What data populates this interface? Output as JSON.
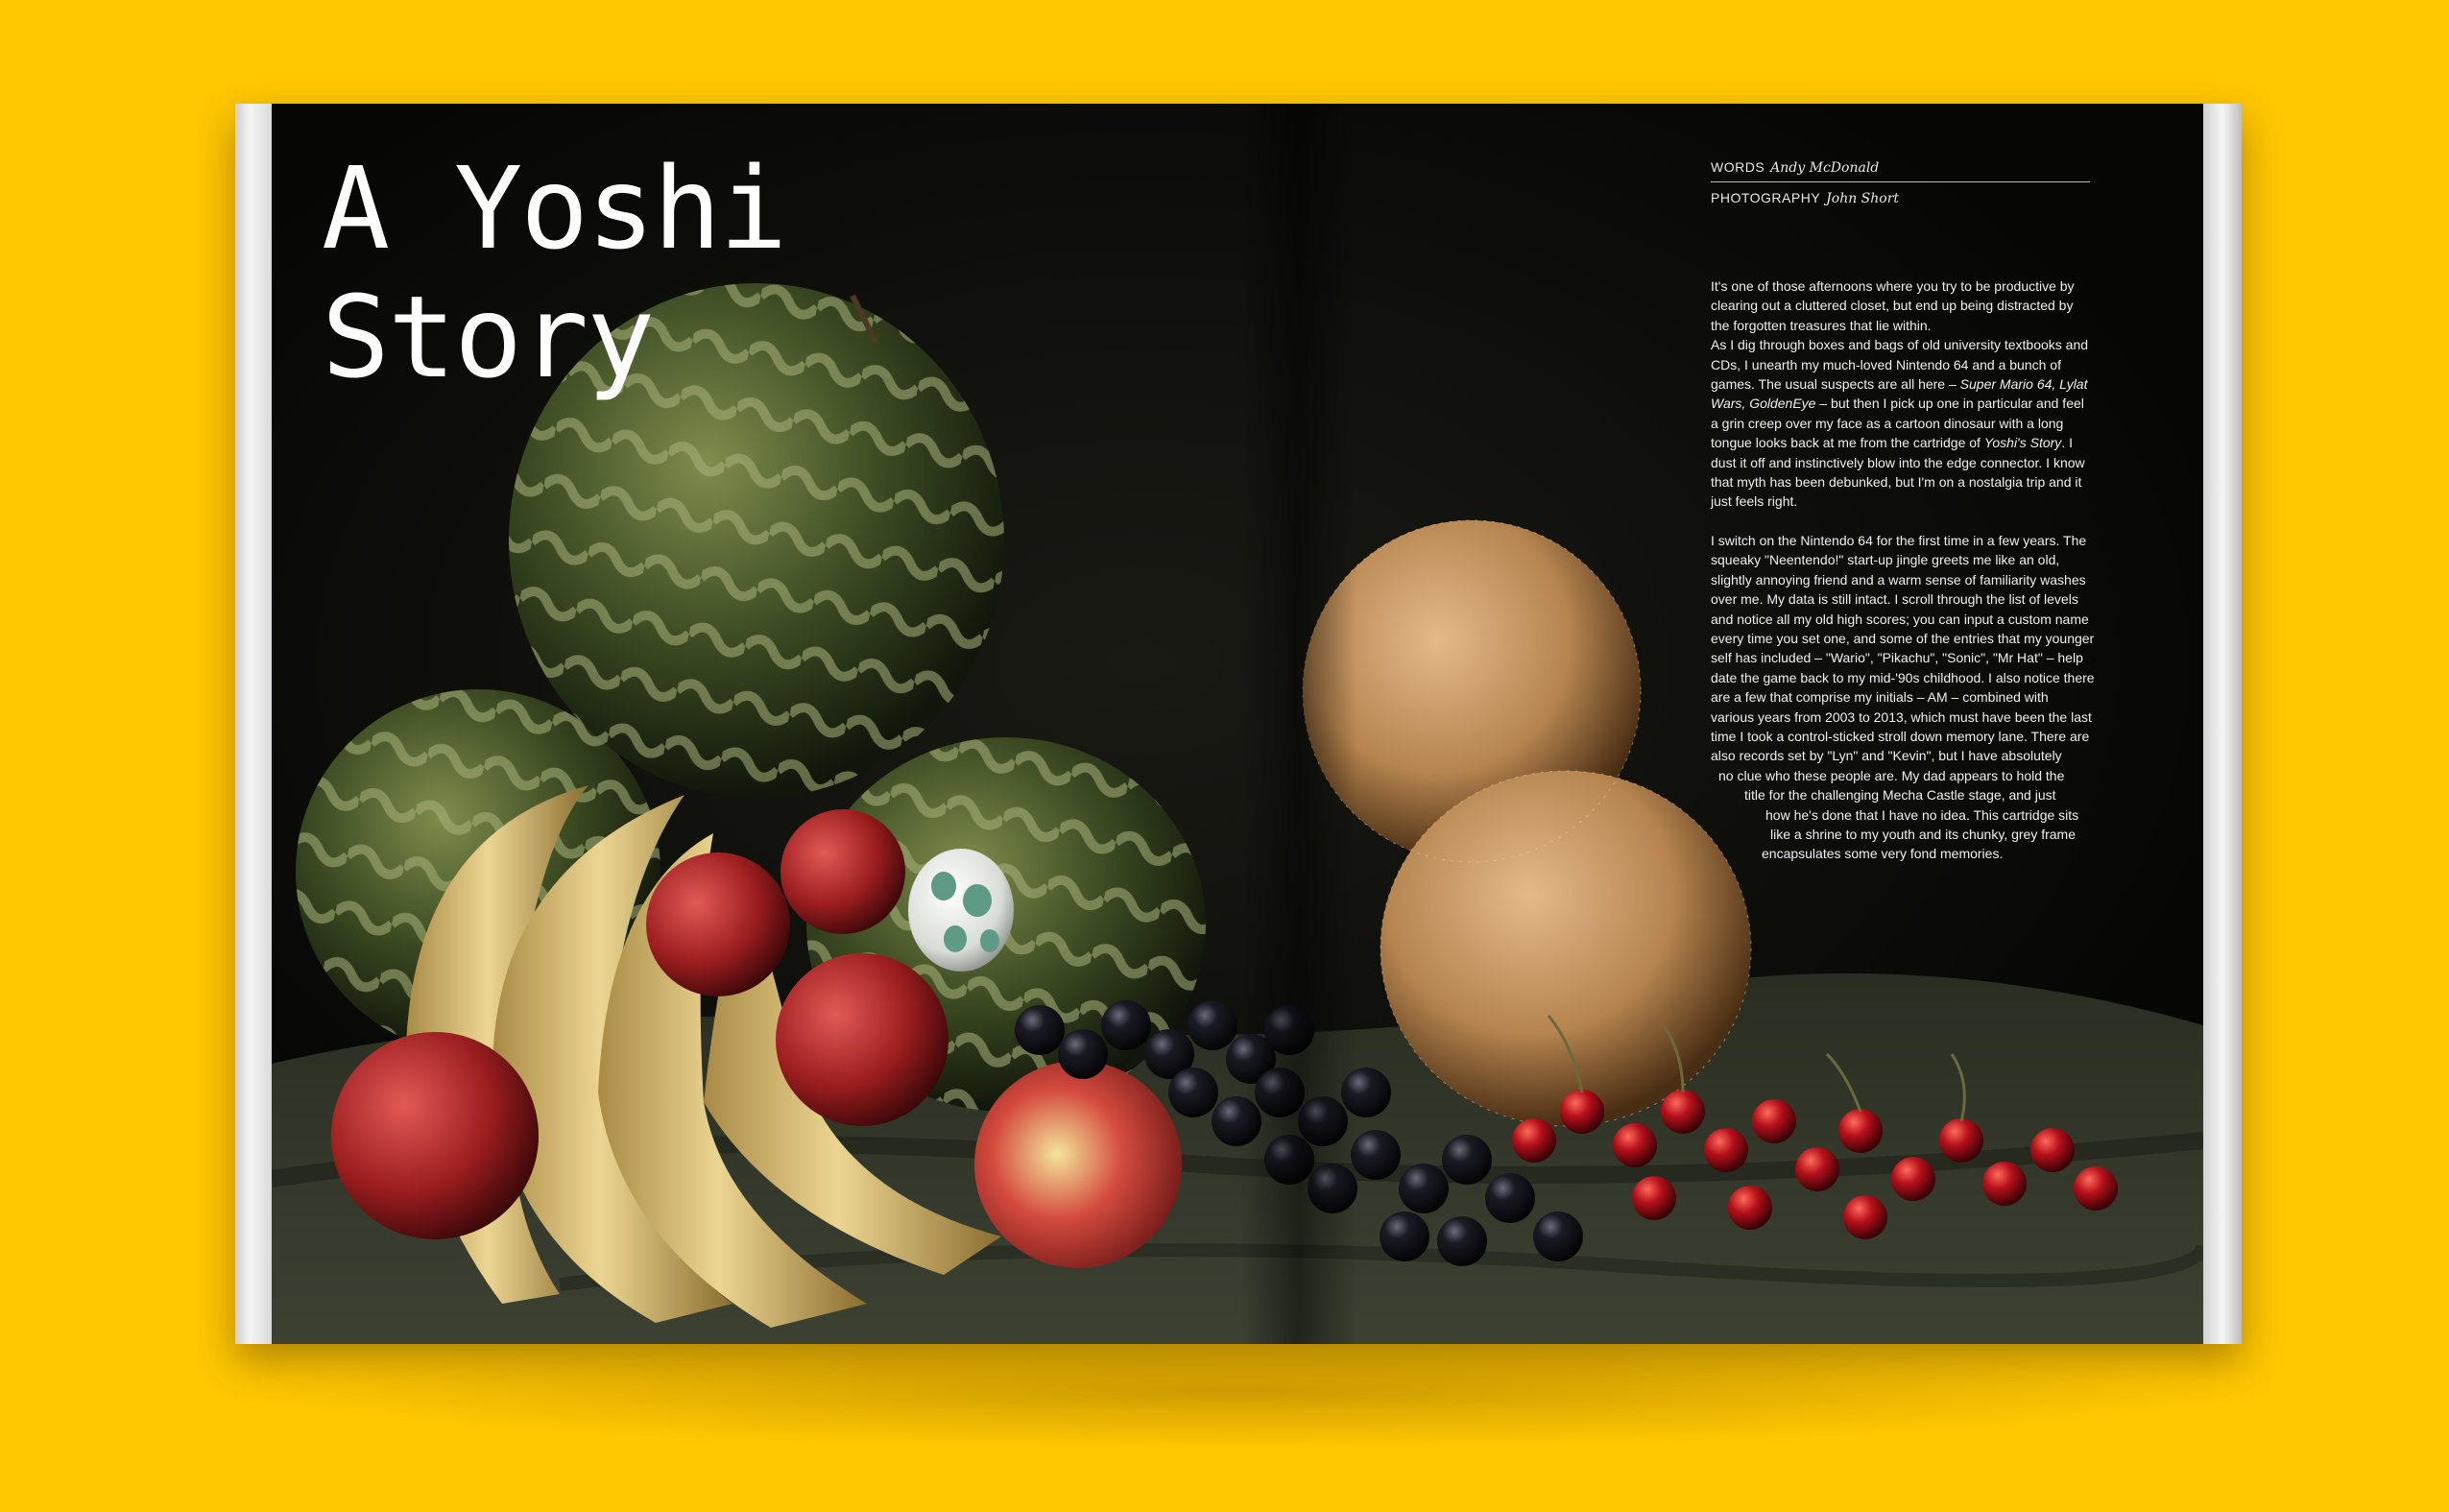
{
  "article": {
    "title_line1": "A Yoshi",
    "title_line2": "Story",
    "words_label": "WORDS",
    "words_author": "Andy McDonald",
    "photo_label": "PHOTOGRAPHY",
    "photo_author": "John Short",
    "para1": {
      "a": "It's one of those afternoons where you try to be productive by clearing out a cluttered closet, but end up being distracted by the forgotten treasures that lie within.\nAs I dig through boxes and bags of old university textbooks and CDs, I unearth my much-loved Nintendo 64 and a bunch of games. The usual suspects are all here – ",
      "games": "Super Mario 64, Lylat Wars, GoldenEye",
      "b": " – but then I pick up one in particular and feel a grin creep over my face as a cartoon dinosaur with a long tongue looks back at me from the cartridge of ",
      "cart": "Yoshi's Story",
      "c": ". I dust it off and instinctively blow into the edge connector. I know that myth has been debunked, but I'm on a nostalgia trip and it just feels right."
    },
    "para2": {
      "main": "I switch on the Nintendo 64 for the first time in a few years. The squeaky \"Neentendo!\" start-up jingle greets me like an old, slightly annoying friend and a warm sense of familiarity washes over me. My data is still intact. I scroll through the list of levels and notice all my old high scores; you can input a custom name every time you set one, and some of the entries that my younger self has included – \"Wario\", \"Pikachu\", \"Sonic\", \"Mr Hat\" – help date the game back to my mid-'90s childhood. I also notice there are a few that comprise my initials – AM – combined with various years from 2003 to 2013, which must have been the last time I took a control-sticked stroll down memory lane. There are also records set by \"Lyn\" and \"Kevin\", but I have absolutely",
      "l1": "no clue who these people are. My dad appears to hold the",
      "l2": "title for the challenging Mecha Castle stage, and just",
      "l3": "how he's done that I have no idea. This cartridge sits",
      "l4": "like a shrine to my youth and its chunky, grey frame",
      "l5": "encapsulates some very fond memories."
    }
  }
}
